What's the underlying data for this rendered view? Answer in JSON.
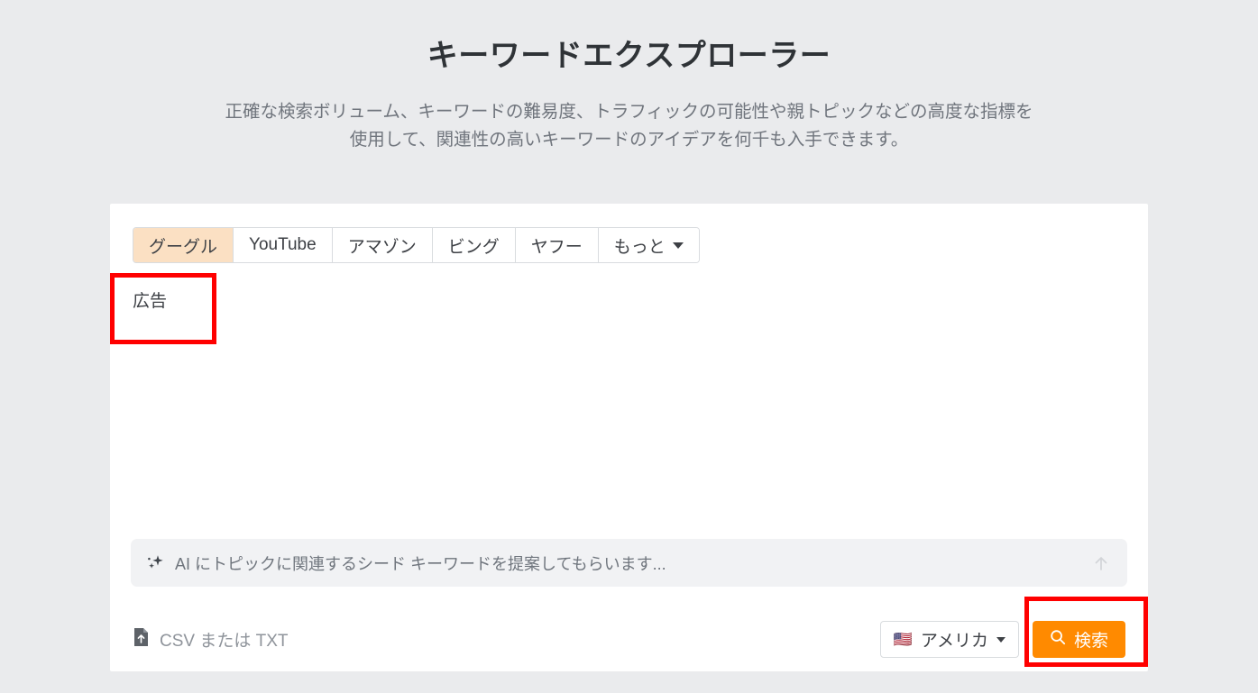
{
  "header": {
    "title": "キーワードエクスプローラー",
    "subtitle_line1": "正確な検索ボリューム、キーワードの難易度、トラフィックの可能性や親トピックなどの高度な指標を",
    "subtitle_line2": "使用して、関連性の高いキーワードのアイデアを何千も入手できます。"
  },
  "tabs": [
    {
      "label": "グーグル",
      "active": true
    },
    {
      "label": "YouTube",
      "active": false
    },
    {
      "label": "アマゾン",
      "active": false
    },
    {
      "label": "ビング",
      "active": false
    },
    {
      "label": "ヤフー",
      "active": false
    },
    {
      "label": "もっと",
      "active": false,
      "has_caret": true
    }
  ],
  "keyword_input": {
    "value": "広告",
    "highlighted": true
  },
  "ai_prompt": {
    "icon": "sparkle-icon",
    "placeholder": "AI にトピックに関連するシード キーワードを提案してもらいます...",
    "submit_icon": "arrow-up-icon"
  },
  "footer": {
    "upload": {
      "icon": "file-upload-icon",
      "label": "CSV または TXT"
    },
    "country": {
      "flag": "🇺🇸",
      "label": "アメリカ",
      "caret": "chevron-down-icon"
    },
    "search_button": {
      "icon": "search-icon",
      "label": "検索"
    }
  },
  "annotations": {
    "color": "#ff0000",
    "boxes": [
      "keyword-input",
      "search-button"
    ]
  },
  "colors": {
    "page_background": "#eaebed",
    "card_background": "#ffffff",
    "accent_orange": "#ff8a00",
    "active_tab": "#fbe0c3",
    "annotation_red": "#ff0000",
    "muted_text": "#70757d"
  }
}
